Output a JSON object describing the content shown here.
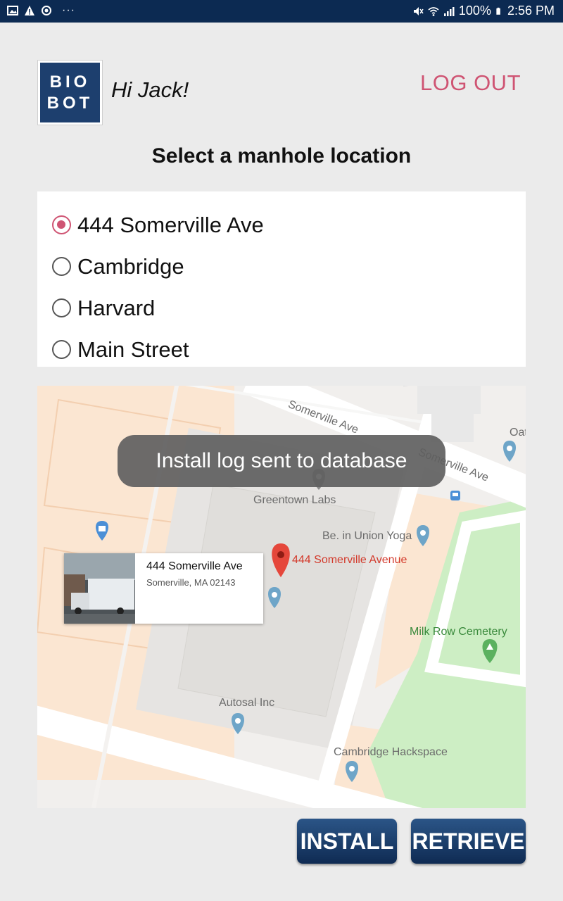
{
  "status_bar": {
    "battery": "100%",
    "time": "2:56 PM",
    "left_icons": [
      "image-icon",
      "alert-icon",
      "sync-icon"
    ],
    "right_icons": [
      "mute-icon",
      "wifi-icon",
      "signal-icon",
      "battery-icon"
    ]
  },
  "header": {
    "logo_line1": "BIO",
    "logo_line2": "BOT",
    "greeting": "Hi Jack!",
    "logout_label": "LOG OUT"
  },
  "page_title": "Select a manhole location",
  "locations": [
    {
      "label": "444 Somerville Ave",
      "selected": true
    },
    {
      "label": "Cambridge",
      "selected": false
    },
    {
      "label": "Harvard",
      "selected": false
    },
    {
      "label": "Main Street",
      "selected": false
    }
  ],
  "map": {
    "street_labels": [
      "Somerville Ave",
      "Somerville Ave"
    ],
    "partial_label": "Oat",
    "places": [
      "Greentown Labs",
      "Be. in Union Yoga",
      "Milk Row Cemetery",
      "Autosal Inc",
      "Cambridge Hackspace"
    ],
    "marker_label": "444 Somerville Avenue",
    "info_card": {
      "name": "444 Somerville Ave",
      "address": "Somerville, MA 02143"
    },
    "colors": {
      "pin": "#e5473b",
      "poi": "#6ea5c8",
      "park": "#cdeec4"
    }
  },
  "toast": "Install log sent to database",
  "buttons": {
    "install": "INSTALL",
    "retrieve": "RETRIEVE"
  },
  "colors": {
    "accent": "#cf5473",
    "primary": "#1d3f6e",
    "status_bar": "#0c2a52"
  }
}
